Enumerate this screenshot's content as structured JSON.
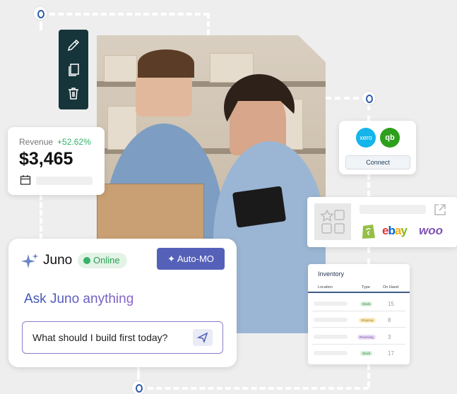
{
  "revenue": {
    "label": "Revenue",
    "change": "+52.62%",
    "value": "$3,465"
  },
  "integrations": {
    "connect_label": "Connect",
    "xero_label": "xero",
    "qb_label": "qb"
  },
  "marketplaces": {
    "shopify_icon": "shopify-icon",
    "ebay_label": "ebay",
    "woo_label": "woo"
  },
  "juno": {
    "name": "Juno",
    "status": "Online",
    "automo_label": "Auto-MO",
    "heading": "Ask Juno anything",
    "prompt_value": "What should I build first today?"
  },
  "inventory": {
    "title": "Inventory",
    "columns": [
      "Location",
      "Type",
      "On Hand"
    ],
    "rows": [
      {
        "type": "Stock",
        "qty": "15"
      },
      {
        "type": "Shipping",
        "qty": "8"
      },
      {
        "type": "Receiving",
        "qty": "3"
      },
      {
        "type": "Stock",
        "qty": "17"
      }
    ]
  },
  "colors": {
    "accent": "#5561b8",
    "toolbar": "#16353a",
    "online": "#35b368",
    "positive": "#2bb36a"
  }
}
